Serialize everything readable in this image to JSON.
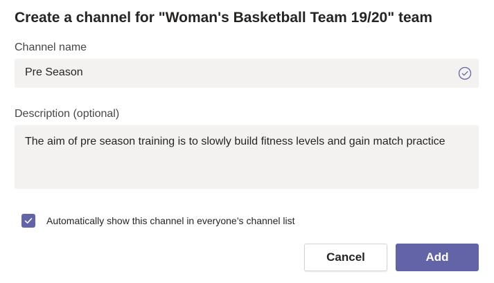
{
  "dialog": {
    "title": "Create a channel for \"Woman's Basketball Team 19/20\" team"
  },
  "channel_name": {
    "label": "Channel name",
    "value": "Pre Season",
    "status_icon": "check-circle-icon"
  },
  "description": {
    "label": "Description (optional)",
    "value": "The aim of pre season training is to slowly build fitness levels and gain match practice"
  },
  "auto_show": {
    "checked": true,
    "label": "Automatically show this channel in everyone’s channel list"
  },
  "buttons": {
    "cancel_label": "Cancel",
    "add_label": "Add"
  },
  "colors": {
    "accent": "#6264a7",
    "field_background": "#f3f2f1",
    "text": "#252423"
  }
}
